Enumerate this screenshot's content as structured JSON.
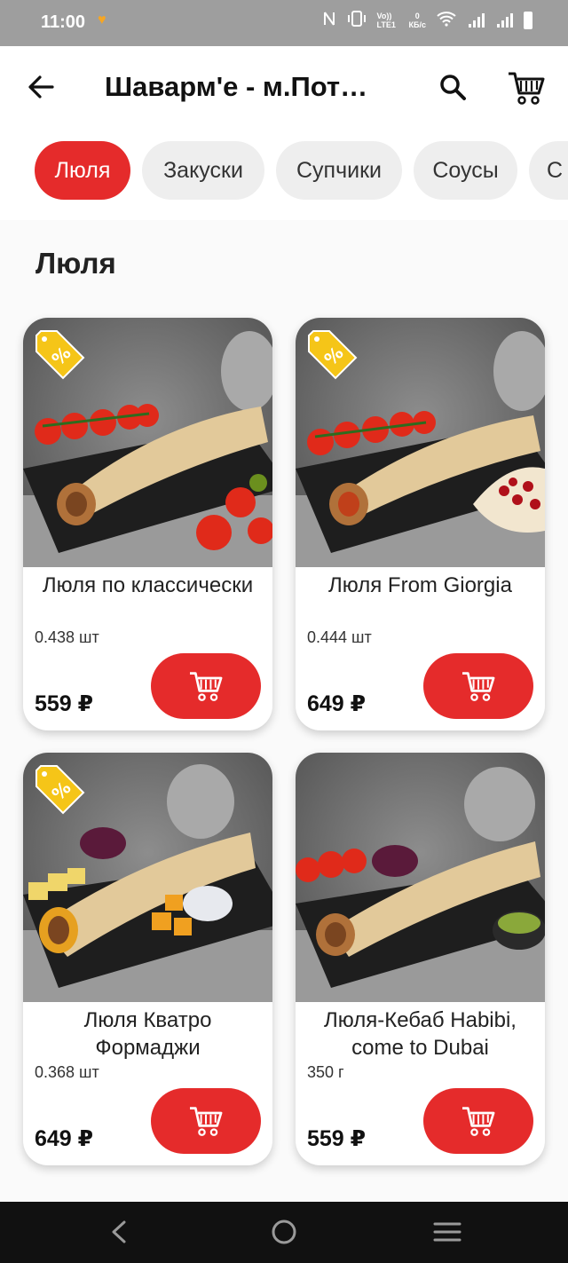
{
  "status_bar": {
    "time": "11:00",
    "net_speed_value": "0",
    "net_speed_unit": "КБ/с",
    "volte": "Vo)) LTE1"
  },
  "header": {
    "title": "Шаварм'е - м.Пот…",
    "back_icon": "arrow-left-icon",
    "search_icon": "search-icon",
    "cart_icon": "cart-icon"
  },
  "categories": [
    {
      "label": "Люля",
      "active": true
    },
    {
      "label": "Закуски",
      "active": false
    },
    {
      "label": "Супчики",
      "active": false
    },
    {
      "label": "Соусы",
      "active": false
    },
    {
      "label": "С",
      "active": false
    }
  ],
  "section": {
    "title": "Люля"
  },
  "products": [
    {
      "name": "Люля по классически",
      "weight": "0.438 шт",
      "price": "559 ₽",
      "discount": true,
      "garnish": "tomatoes"
    },
    {
      "name": "Люля From Giorgia",
      "weight": "0.444 шт",
      "price": "649 ₽",
      "discount": true,
      "garnish": "pomegranate"
    },
    {
      "name": "Люля Кватро Формаджи",
      "weight": "0.368 шт",
      "price": "649 ₽",
      "discount": true,
      "garnish": "cheese"
    },
    {
      "name": "Люля-Кебаб Habibi, come to Dubai",
      "weight": "350 г",
      "price": "559 ₽",
      "discount": false,
      "garnish": "tomatoes"
    }
  ],
  "colors": {
    "accent": "#e52b2b",
    "badge": "#f5c518",
    "status_bar": "#9e9e9e",
    "nav_bar": "#111111"
  }
}
